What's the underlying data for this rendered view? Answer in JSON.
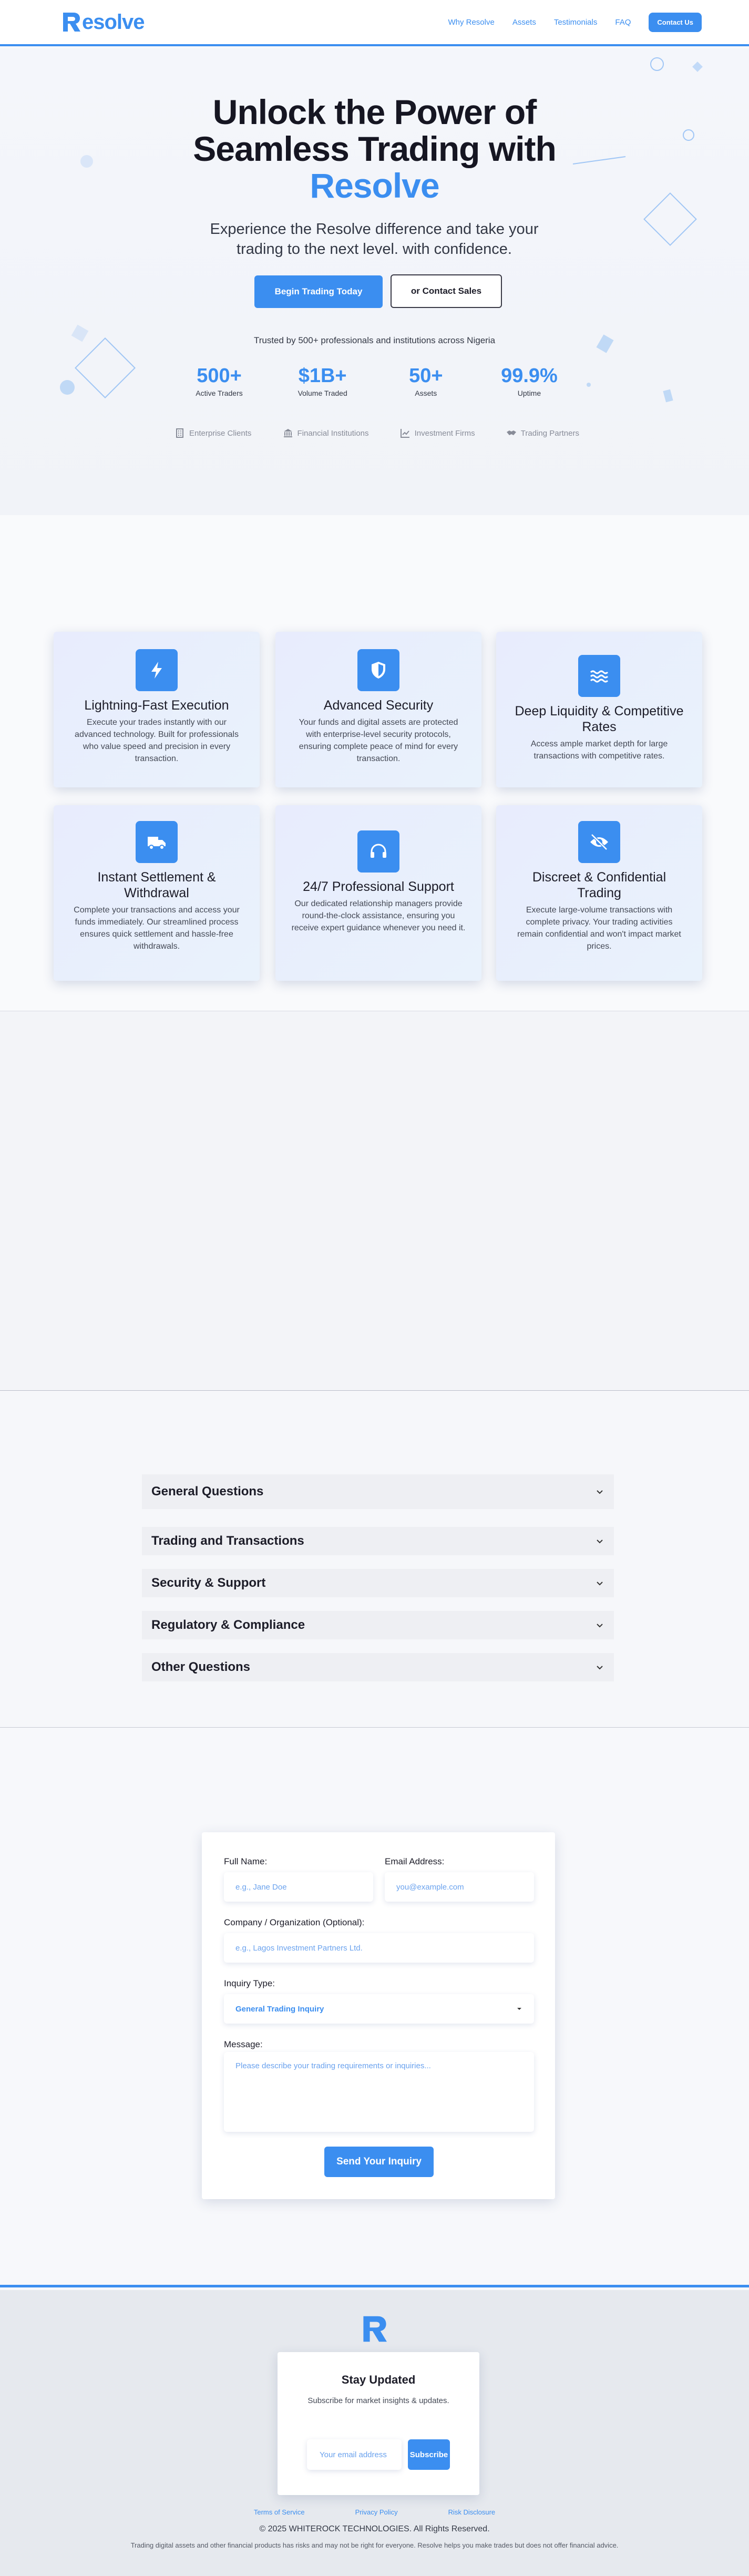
{
  "nav": {
    "logo_text": "esolve",
    "links": [
      "Why Resolve",
      "Assets",
      "Testimonials",
      "FAQ"
    ],
    "cta": "Contact Us"
  },
  "hero": {
    "title_line1": "Unlock the Power of",
    "title_line2": "Seamless Trading with",
    "title_accent": "Resolve",
    "subtitle": "Experience the Resolve difference and take your trading to the next level. with confidence.",
    "primary_button": "Begin Trading Today",
    "secondary_button": "or Contact Sales",
    "trust_text": "Trusted by 500+ professionals and institutions across Nigeria",
    "stats": [
      {
        "value": "500+",
        "label": "Active Traders"
      },
      {
        "value": "$1B+",
        "label": "Volume Traded"
      },
      {
        "value": "50+",
        "label": "Assets"
      },
      {
        "value": "99.9%",
        "label": "Uptime"
      }
    ],
    "partners": [
      "Enterprise Clients",
      "Financial Institutions",
      "Investment Firms",
      "Trading Partners"
    ]
  },
  "features": [
    {
      "icon": "bolt-icon",
      "title": "Lightning-Fast Execution",
      "text": "Execute your trades instantly with our advanced technology. Built for professionals who value speed and precision in every transaction."
    },
    {
      "icon": "shield-icon",
      "title": "Advanced Security",
      "text": "Your funds and digital assets are protected with enterprise-level security protocols, ensuring complete peace of mind for every transaction."
    },
    {
      "icon": "waves-icon",
      "title": "Deep Liquidity & Competitive Rates",
      "text": "Access ample market depth for large transactions with competitive rates."
    },
    {
      "icon": "truck-icon",
      "title": "Instant Settlement & Withdrawal",
      "text": "Complete your transactions and access your funds immediately. Our streamlined process ensures quick settlement and hassle-free withdrawals."
    },
    {
      "icon": "headset-icon",
      "title": "24/7 Professional Support",
      "text": "Our dedicated relationship managers provide round-the-clock assistance, ensuring you receive expert guidance whenever you need it."
    },
    {
      "icon": "eye-slash-icon",
      "title": "Discreet & Confidential Trading",
      "text": "Execute large-volume transactions with complete privacy. Your trading activities remain confidential and won't impact market prices."
    }
  ],
  "faq": [
    "General Questions",
    "Trading and Transactions",
    "Security & Support",
    "Regulatory & Compliance",
    "Other Questions"
  ],
  "contact": {
    "full_name_label": "Full Name:",
    "full_name_placeholder": "e.g., Jane Doe",
    "email_label": "Email Address:",
    "email_placeholder": "you@example.com",
    "company_label": "Company / Organization (Optional):",
    "company_placeholder": "e.g., Lagos Investment Partners Ltd.",
    "inquiry_label": "Inquiry Type:",
    "inquiry_value": "General Trading Inquiry",
    "message_label": "Message:",
    "message_placeholder": "Please describe your trading requirements or inquiries...",
    "submit": "Send Your Inquiry"
  },
  "footer": {
    "sub_title": "Stay Updated",
    "sub_text": "Subscribe for market insights & updates.",
    "email_placeholder": "Your email address",
    "subscribe": "Subscribe",
    "links": [
      "Terms of Service",
      "Privacy Policy",
      "Risk Disclosure"
    ],
    "copyright": "© 2025 WHITEROCK TECHNOLOGIES. All Rights Reserved.",
    "disclaimer": "Trading digital assets and other financial products has risks and may not be right for everyone. Resolve helps you make trades but does not offer financial advice."
  },
  "colors": {
    "accent": "#3b8ef0",
    "text": "#1c1c28"
  }
}
